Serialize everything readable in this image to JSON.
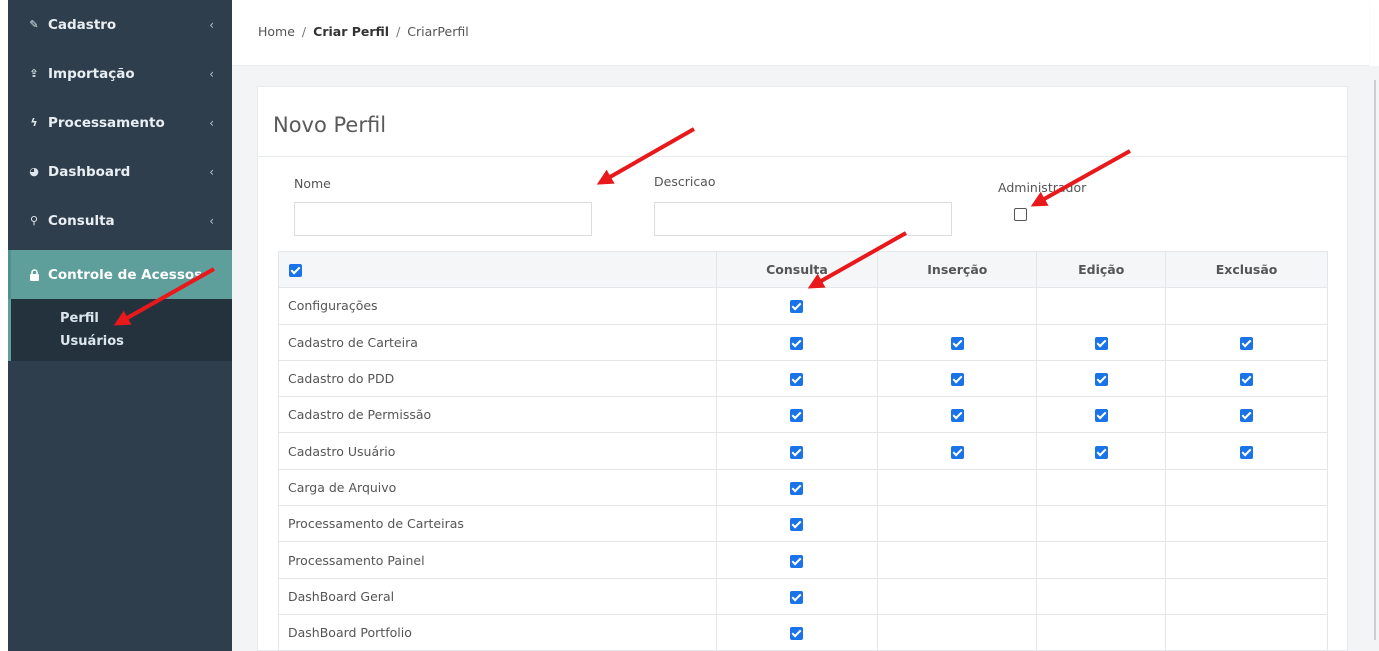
{
  "sidebar": {
    "items": [
      {
        "label": "Cadastro",
        "icon": "edit-icon",
        "glyph": "✎"
      },
      {
        "label": "Importação",
        "icon": "upload-icon",
        "glyph": "⇪"
      },
      {
        "label": "Processamento",
        "icon": "bolt-icon",
        "glyph": "ϟ"
      },
      {
        "label": "Dashboard",
        "icon": "pie-chart-icon",
        "glyph": "◕"
      },
      {
        "label": "Consulta",
        "icon": "binoculars-icon",
        "glyph": "⚲"
      }
    ],
    "active": {
      "label": "Controle de Acessos",
      "icon": "lock-icon",
      "glyph": "🔒"
    },
    "submenu": [
      "Perfil",
      "Usuários"
    ],
    "chevron": "‹"
  },
  "breadcrumb": {
    "home": "Home",
    "criar": "Criar Perfil",
    "current": "CriarPerfil",
    "sep": "/"
  },
  "form": {
    "title": "Novo Perfil",
    "nome_label": "Nome",
    "nome_value": "",
    "descricao_label": "Descricao",
    "descricao_value": "",
    "admin_label": "Administrador",
    "admin_checked": false
  },
  "table": {
    "headers": [
      "Consulta",
      "Inserção",
      "Edição",
      "Exclusão"
    ],
    "rows": [
      {
        "name": "Configurações",
        "perms": [
          true,
          false,
          false,
          false
        ]
      },
      {
        "name": "Cadastro de Carteira",
        "perms": [
          true,
          true,
          true,
          true
        ]
      },
      {
        "name": "Cadastro do PDD",
        "perms": [
          true,
          true,
          true,
          true
        ]
      },
      {
        "name": "Cadastro de Permissão",
        "perms": [
          true,
          true,
          true,
          true
        ]
      },
      {
        "name": "Cadastro Usuário",
        "perms": [
          true,
          true,
          true,
          true
        ]
      },
      {
        "name": "Carga de Arquivo",
        "perms": [
          true,
          false,
          false,
          false
        ]
      },
      {
        "name": "Processamento de Carteiras",
        "perms": [
          true,
          false,
          false,
          false
        ]
      },
      {
        "name": "Processamento Painel",
        "perms": [
          true,
          false,
          false,
          false
        ]
      },
      {
        "name": "DashBoard Geral",
        "perms": [
          true,
          false,
          false,
          false
        ]
      },
      {
        "name": "DashBoard Portfolio",
        "perms": [
          true,
          false,
          false,
          false
        ]
      }
    ]
  },
  "colors": {
    "sidebar_bg": "#2f3e4c",
    "sidebar_active": "#5e9f9c",
    "checkbox": "#1a73e8",
    "arrow": "#e8181b"
  }
}
